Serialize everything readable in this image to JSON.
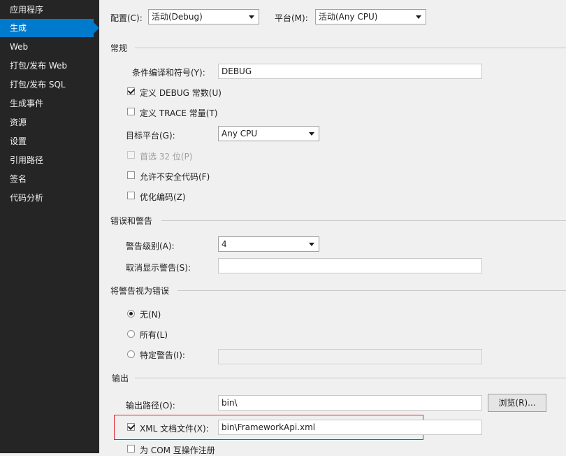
{
  "sidebar": {
    "items": [
      {
        "label": "应用程序"
      },
      {
        "label": "生成",
        "active": true
      },
      {
        "label": "Web"
      },
      {
        "label": "打包/发布 Web"
      },
      {
        "label": "打包/发布 SQL"
      },
      {
        "label": "生成事件"
      },
      {
        "label": "资源"
      },
      {
        "label": "设置"
      },
      {
        "label": "引用路径"
      },
      {
        "label": "签名"
      },
      {
        "label": "代码分析"
      }
    ]
  },
  "toolbar": {
    "config_label": "配置(C):",
    "config_value": "活动(Debug)",
    "platform_label": "平台(M):",
    "platform_value": "活动(Any CPU)"
  },
  "general": {
    "title": "常规",
    "symbols_label": "条件编译和符号(Y):",
    "symbols_value": "DEBUG",
    "define_debug_label": "定义 DEBUG 常数(U)",
    "define_debug_checked": true,
    "define_trace_label": "定义 TRACE 常量(T)",
    "define_trace_checked": false,
    "target_platform_label": "目标平台(G):",
    "target_platform_value": "Any CPU",
    "prefer32_label": "首选 32 位(P)",
    "prefer32_checked": false,
    "unsafe_label": "允许不安全代码(F)",
    "unsafe_checked": false,
    "optimize_label": "优化编码(Z)",
    "optimize_checked": false
  },
  "errors": {
    "title": "错误和警告",
    "warning_level_label": "警告级别(A):",
    "warning_level_value": "4",
    "suppress_label": "取消显示警告(S):",
    "suppress_value": ""
  },
  "treat_warnings": {
    "title": "将警告视为错误",
    "none_label": "无(N)",
    "all_label": "所有(L)",
    "specific_label": "特定警告(I):",
    "selected": "none",
    "specific_value": ""
  },
  "output": {
    "title": "输出",
    "path_label": "输出路径(O):",
    "path_value": "bin\\",
    "browse_label": "浏览(R)...",
    "xml_doc_label": "XML 文档文件(X):",
    "xml_doc_checked": true,
    "xml_doc_value": "bin\\FrameworkApi.xml",
    "com_label": "为 COM 互操作注册"
  },
  "colors": {
    "sidebar_bg": "#252526",
    "accent": "#007acc",
    "highlight": "#e0202e"
  }
}
